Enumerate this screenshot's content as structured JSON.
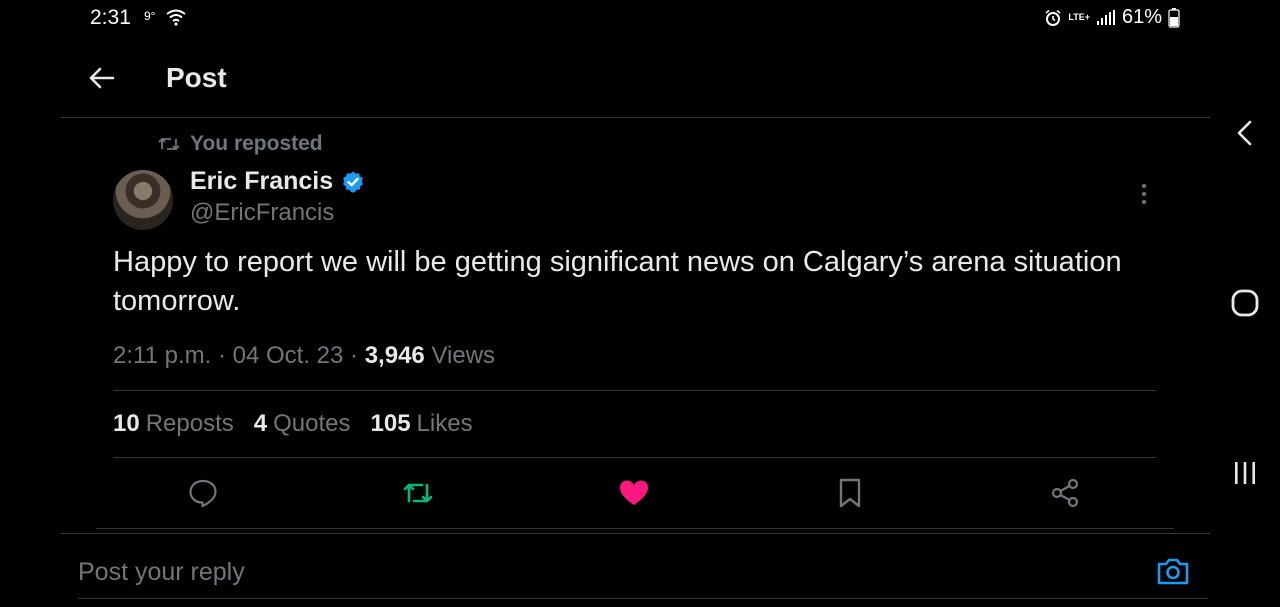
{
  "status_bar": {
    "time": "2:31",
    "temperature": "9°",
    "network": "LTE+",
    "battery": "61%"
  },
  "header": {
    "title": "Post"
  },
  "tweet": {
    "repost_label": "You reposted",
    "author_name": "Eric Francis",
    "verified": true,
    "handle": "@EricFrancis",
    "text": "Happy to report we will be getting significant news on Calgary’s arena situation tomorrow.",
    "time": "2:11 p.m.",
    "separator": "·",
    "date": "04 Oct. 23",
    "views_count": "3,946",
    "views_label": "Views",
    "stats": {
      "reposts_count": "10",
      "reposts_label": "Reposts",
      "quotes_count": "4",
      "quotes_label": "Quotes",
      "likes_count": "105",
      "likes_label": "Likes"
    },
    "actions": [
      "reply-icon",
      "repost-icon",
      "like-icon",
      "bookmark-icon",
      "share-icon"
    ]
  },
  "reply": {
    "placeholder": "Post your reply"
  },
  "colors": {
    "background": "#000000",
    "text_primary": "#e7e9ea",
    "text_secondary": "#71767b",
    "divider": "#2f3336",
    "verified_blue": "#1d9bf0",
    "repost_green": "#00ba7c",
    "like_pink": "#f91880"
  }
}
